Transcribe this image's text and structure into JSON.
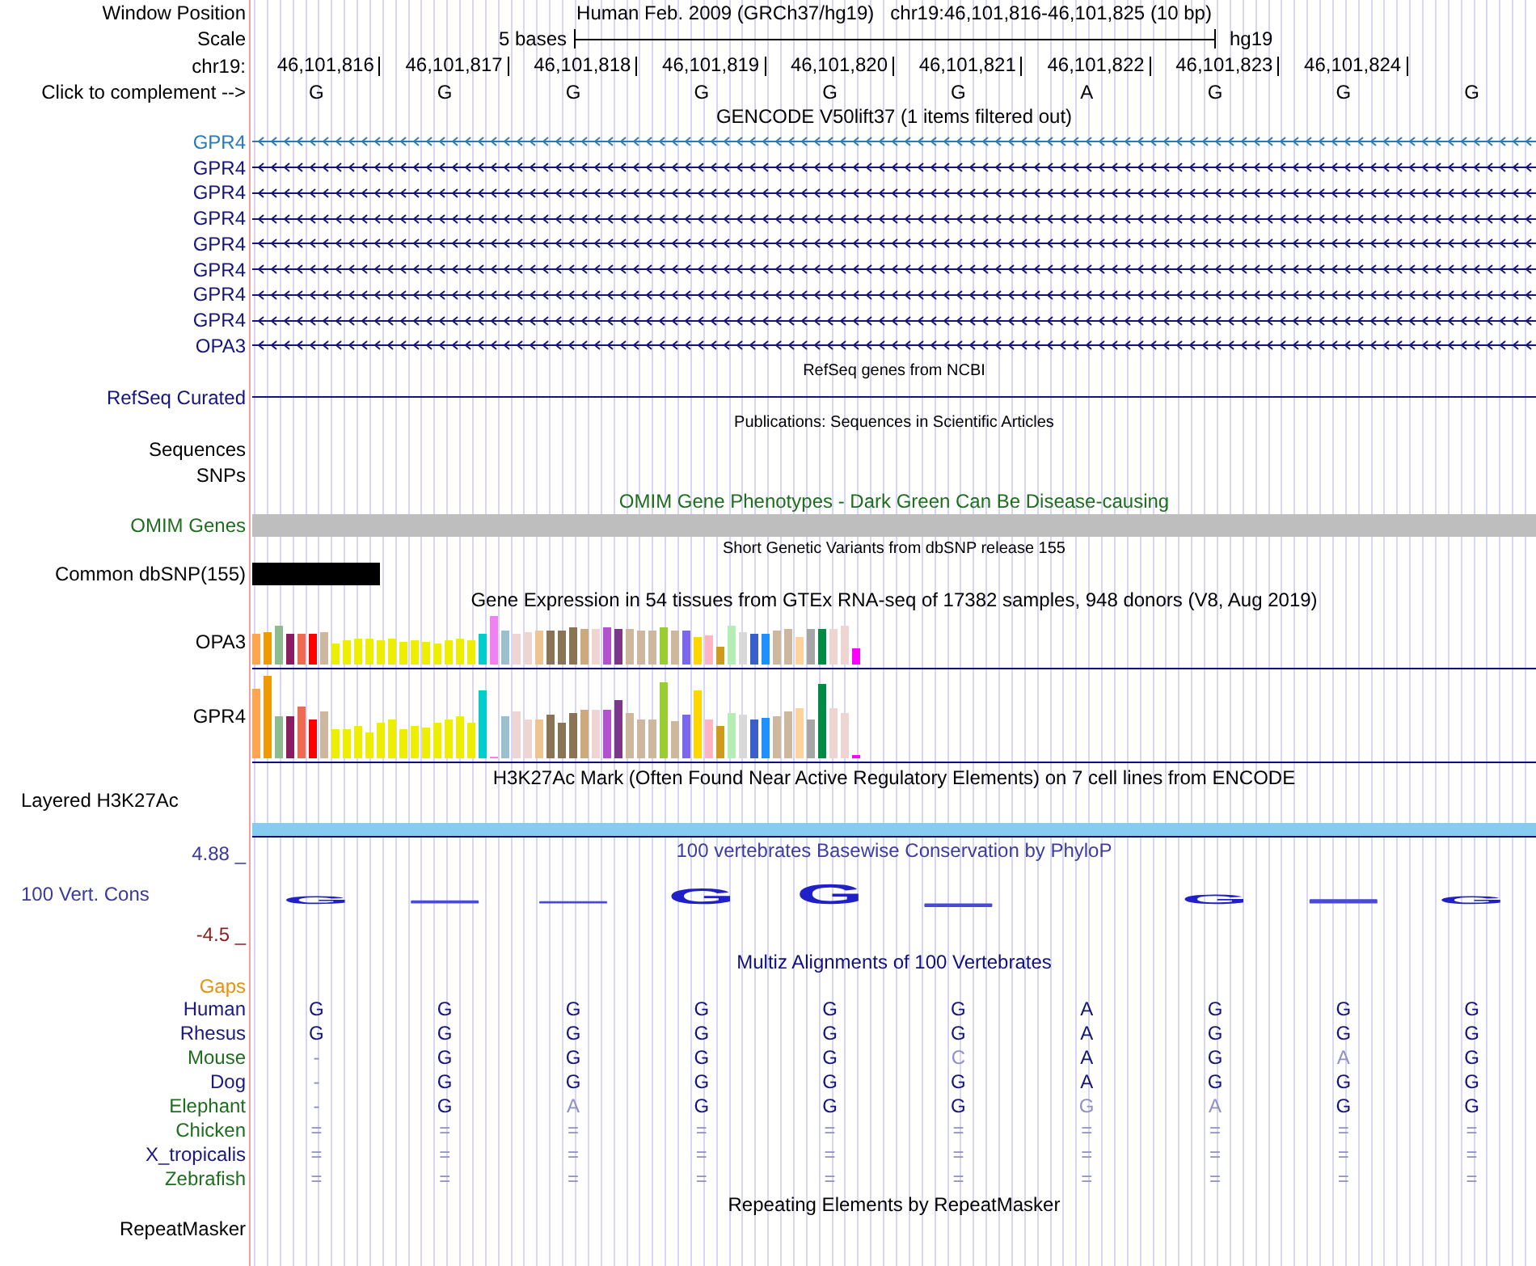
{
  "position": {
    "label": "Window Position",
    "assembly": "Human Feb. 2009 (GRCh37/hg19)",
    "range": "chr19:46,101,816-46,101,825 (10 bp)"
  },
  "scale": {
    "label": "Scale",
    "size": "5 bases",
    "db": "hg19"
  },
  "ruler": {
    "label": "chr19:",
    "ticks": [
      "46,101,816",
      "46,101,817",
      "46,101,818",
      "46,101,819",
      "46,101,820",
      "46,101,821",
      "46,101,822",
      "46,101,823",
      "46,101,824"
    ]
  },
  "bases": {
    "label": "Click to complement -->",
    "letters": [
      "G",
      "G",
      "G",
      "G",
      "G",
      "G",
      "A",
      "G",
      "G",
      "G"
    ]
  },
  "tracks": [
    {
      "kind": "genes",
      "title": "GENCODE V50lift37 (1 items filtered out)",
      "items": [
        {
          "name": "GPR4",
          "color": "#2a7ab8",
          "reverse_strand": true
        },
        {
          "name": "GPR4",
          "color": "#14147a",
          "reverse_strand": true
        },
        {
          "name": "GPR4",
          "color": "#14147a",
          "reverse_strand": true
        },
        {
          "name": "GPR4",
          "color": "#14147a",
          "reverse_strand": true
        },
        {
          "name": "GPR4",
          "color": "#14147a",
          "reverse_strand": true
        },
        {
          "name": "GPR4",
          "color": "#14147a",
          "reverse_strand": true
        },
        {
          "name": "GPR4",
          "color": "#14147a",
          "reverse_strand": true
        },
        {
          "name": "GPR4",
          "color": "#14147a",
          "reverse_strand": true
        },
        {
          "name": "OPA3",
          "color": "#14147a",
          "reverse_strand": true
        }
      ]
    },
    {
      "kind": "refseq",
      "title": "RefSeq genes from NCBI",
      "label": "RefSeq Curated"
    },
    {
      "kind": "pubs",
      "title": "Publications: Sequences in Scientific Articles",
      "labels": [
        "Sequences",
        "SNPs"
      ]
    },
    {
      "kind": "omim",
      "title": "OMIM Gene Phenotypes - Dark Green Can Be Disease-causing",
      "label": "OMIM Genes"
    },
    {
      "kind": "snp",
      "title": "Short Genetic Variants from dbSNP release 155",
      "label": "Common dbSNP(155)"
    },
    {
      "kind": "gtex",
      "title": "Gene Expression in 54 tissues from GTEx RNA-seq of 17382 samples, 948 donors (V8, Aug 2019)",
      "genes": [
        "OPA3",
        "GPR4"
      ]
    },
    {
      "kind": "chipseq",
      "title": "H3K27Ac Mark (Often Found Near Active Regulatory Elements) on 7 cell lines from ENCODE",
      "label": "Layered H3K27Ac"
    },
    {
      "kind": "phylop",
      "title": "100 vertebrates Basewise Conservation by PhyloP",
      "label": "100 Vert. Cons",
      "max_label": "4.88 _",
      "min_label": "-4.5 _",
      "letters": [
        "G",
        "G",
        "G",
        "G",
        "G"
      ]
    },
    {
      "kind": "multiz",
      "title": "Multiz Alignments of 100 Vertebrates",
      "gaps_label": "Gaps",
      "species": [
        {
          "name": "Human",
          "color": "#191980",
          "bases": [
            {
              "base": "G",
              "dimmed": false
            },
            {
              "base": "G",
              "dimmed": false
            },
            {
              "base": "G",
              "dimmed": false
            },
            {
              "base": "G",
              "dimmed": false
            },
            {
              "base": "G",
              "dimmed": false
            },
            {
              "base": "G",
              "dimmed": false
            },
            {
              "base": "A",
              "dimmed": false
            },
            {
              "base": "G",
              "dimmed": false
            },
            {
              "base": "G",
              "dimmed": false
            },
            {
              "base": "G",
              "dimmed": false
            }
          ]
        },
        {
          "name": "Rhesus",
          "color": "#191980",
          "bases": [
            {
              "base": "G",
              "dimmed": false
            },
            {
              "base": "G",
              "dimmed": false
            },
            {
              "base": "G",
              "dimmed": false
            },
            {
              "base": "G",
              "dimmed": false
            },
            {
              "base": "G",
              "dimmed": false
            },
            {
              "base": "G",
              "dimmed": false
            },
            {
              "base": "A",
              "dimmed": false
            },
            {
              "base": "G",
              "dimmed": false
            },
            {
              "base": "G",
              "dimmed": false
            },
            {
              "base": "G",
              "dimmed": false
            }
          ]
        },
        {
          "name": "Mouse",
          "color": "#1e6e1e",
          "bases": [
            {
              "base": "-",
              "dimmed": true
            },
            {
              "base": "G",
              "dimmed": false
            },
            {
              "base": "G",
              "dimmed": false
            },
            {
              "base": "G",
              "dimmed": false
            },
            {
              "base": "G",
              "dimmed": false
            },
            {
              "base": "C",
              "dimmed": true
            },
            {
              "base": "A",
              "dimmed": false
            },
            {
              "base": "G",
              "dimmed": false
            },
            {
              "base": "A",
              "dimmed": true
            },
            {
              "base": "G",
              "dimmed": false
            }
          ]
        },
        {
          "name": "Dog",
          "color": "#191980",
          "bases": [
            {
              "base": "-",
              "dimmed": true
            },
            {
              "base": "G",
              "dimmed": false
            },
            {
              "base": "G",
              "dimmed": false
            },
            {
              "base": "G",
              "dimmed": false
            },
            {
              "base": "G",
              "dimmed": false
            },
            {
              "base": "G",
              "dimmed": false
            },
            {
              "base": "A",
              "dimmed": false
            },
            {
              "base": "G",
              "dimmed": false
            },
            {
              "base": "G",
              "dimmed": false
            },
            {
              "base": "G",
              "dimmed": false
            }
          ]
        },
        {
          "name": "Elephant",
          "color": "#1e6e1e",
          "bases": [
            {
              "base": "-",
              "dimmed": true
            },
            {
              "base": "G",
              "dimmed": false
            },
            {
              "base": "A",
              "dimmed": true
            },
            {
              "base": "G",
              "dimmed": false
            },
            {
              "base": "G",
              "dimmed": false
            },
            {
              "base": "G",
              "dimmed": false
            },
            {
              "base": "G",
              "dimmed": true
            },
            {
              "base": "A",
              "dimmed": true
            },
            {
              "base": "G",
              "dimmed": false
            },
            {
              "base": "G",
              "dimmed": false
            }
          ]
        },
        {
          "name": "Chicken",
          "color": "#1e6e1e",
          "bases": [
            {
              "base": "=",
              "dimmed": true
            },
            {
              "base": "=",
              "dimmed": true
            },
            {
              "base": "=",
              "dimmed": true
            },
            {
              "base": "=",
              "dimmed": true
            },
            {
              "base": "=",
              "dimmed": true
            },
            {
              "base": "=",
              "dimmed": true
            },
            {
              "base": "=",
              "dimmed": true
            },
            {
              "base": "=",
              "dimmed": true
            },
            {
              "base": "=",
              "dimmed": true
            },
            {
              "base": "=",
              "dimmed": true
            }
          ]
        },
        {
          "name": "X_tropicalis",
          "color": "#191980",
          "bases": [
            {
              "base": "=",
              "dimmed": true
            },
            {
              "base": "=",
              "dimmed": true
            },
            {
              "base": "=",
              "dimmed": true
            },
            {
              "base": "=",
              "dimmed": true
            },
            {
              "base": "=",
              "dimmed": true
            },
            {
              "base": "=",
              "dimmed": true
            },
            {
              "base": "=",
              "dimmed": true
            },
            {
              "base": "=",
              "dimmed": true
            },
            {
              "base": "=",
              "dimmed": true
            },
            {
              "base": "=",
              "dimmed": true
            }
          ]
        },
        {
          "name": "Zebrafish",
          "color": "#1e6e1e",
          "bases": [
            {
              "base": "=",
              "dimmed": true
            },
            {
              "base": "=",
              "dimmed": true
            },
            {
              "base": "=",
              "dimmed": true
            },
            {
              "base": "=",
              "dimmed": true
            },
            {
              "base": "=",
              "dimmed": true
            },
            {
              "base": "=",
              "dimmed": true
            },
            {
              "base": "=",
              "dimmed": true
            },
            {
              "base": "=",
              "dimmed": true
            },
            {
              "base": "=",
              "dimmed": true
            },
            {
              "base": "=",
              "dimmed": true
            }
          ]
        }
      ]
    },
    {
      "kind": "repeats",
      "title": "Repeating Elements by RepeatMasker",
      "labels": [
        "RepeatMasker"
      ]
    }
  ]
}
